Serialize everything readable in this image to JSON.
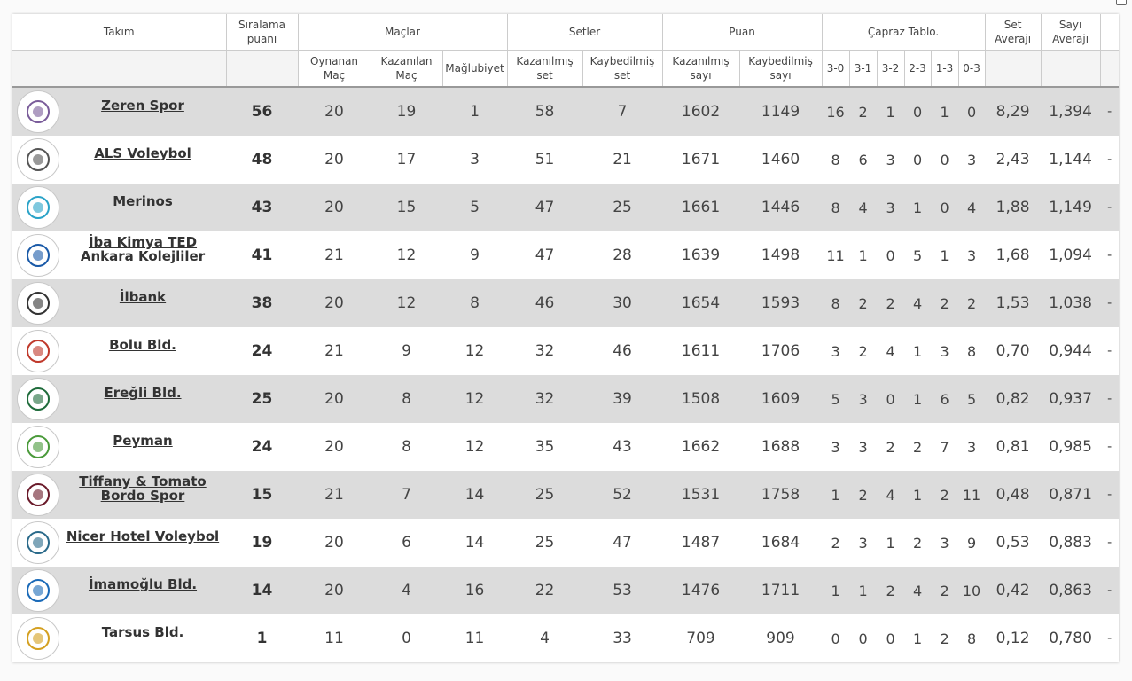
{
  "columns": {
    "takim": "Takım",
    "siralama": "Sıralama puanı",
    "maclar": "Maçlar",
    "setler": "Setler",
    "puan": "Puan",
    "capraz": "Çapraz Tablo.",
    "set_averaji": "Set Averajı",
    "sayi_averaji": "Sayı Averajı",
    "oynanan": "Oynanan Maç",
    "kazanilan": "Kazanılan Maç",
    "maglubiyet": "Mağlubiyet",
    "kazanilmis_set": "Kazanılmış set",
    "kaybedilmis_set": "Kaybedilmiş set",
    "kazanilmis_sayi": "Kazanılmış sayı",
    "kaybedilmis_sayi": "Kaybedilmiş sayı",
    "c30": "3-0",
    "c31": "3-1",
    "c32": "3-2",
    "c23": "2-3",
    "c13": "1-3",
    "c03": "0-3"
  },
  "rows": [
    {
      "team": "Zeren Spor",
      "logo_color": "#7a5c9a",
      "points": "56",
      "played": "20",
      "won": "19",
      "lost": "1",
      "sets_won": "58",
      "sets_lost": "7",
      "pts_won": "1602",
      "pts_lost": "1149",
      "c30": "16",
      "c31": "2",
      "c32": "1",
      "c23": "0",
      "c13": "1",
      "c03": "0",
      "set_avg": "8,29",
      "pt_avg": "1,394",
      "extra": "-"
    },
    {
      "team": "ALS Voleybol",
      "logo_color": "#555555",
      "points": "48",
      "played": "20",
      "won": "17",
      "lost": "3",
      "sets_won": "51",
      "sets_lost": "21",
      "pts_won": "1671",
      "pts_lost": "1460",
      "c30": "8",
      "c31": "6",
      "c32": "3",
      "c23": "0",
      "c13": "0",
      "c03": "3",
      "set_avg": "2,43",
      "pt_avg": "1,144",
      "extra": "-"
    },
    {
      "team": "Merinos",
      "logo_color": "#2aa3c8",
      "points": "43",
      "played": "20",
      "won": "15",
      "lost": "5",
      "sets_won": "47",
      "sets_lost": "25",
      "pts_won": "1661",
      "pts_lost": "1446",
      "c30": "8",
      "c31": "4",
      "c32": "3",
      "c23": "1",
      "c13": "0",
      "c03": "4",
      "set_avg": "1,88",
      "pt_avg": "1,149",
      "extra": "-"
    },
    {
      "team": "İba Kimya TED Ankara Kolejliler",
      "logo_color": "#1a5aa8",
      "points": "41",
      "played": "21",
      "won": "12",
      "lost": "9",
      "sets_won": "47",
      "sets_lost": "28",
      "pts_won": "1639",
      "pts_lost": "1498",
      "c30": "11",
      "c31": "1",
      "c32": "0",
      "c23": "5",
      "c13": "1",
      "c03": "3",
      "set_avg": "1,68",
      "pt_avg": "1,094",
      "extra": "-"
    },
    {
      "team": "İlbank",
      "logo_color": "#333333",
      "points": "38",
      "played": "20",
      "won": "12",
      "lost": "8",
      "sets_won": "46",
      "sets_lost": "30",
      "pts_won": "1654",
      "pts_lost": "1593",
      "c30": "8",
      "c31": "2",
      "c32": "2",
      "c23": "4",
      "c13": "2",
      "c03": "2",
      "set_avg": "1,53",
      "pt_avg": "1,038",
      "extra": "-"
    },
    {
      "team": "Bolu Bld.",
      "logo_color": "#c0392b",
      "points": "24",
      "played": "21",
      "won": "9",
      "lost": "12",
      "sets_won": "32",
      "sets_lost": "46",
      "pts_won": "1611",
      "pts_lost": "1706",
      "c30": "3",
      "c31": "2",
      "c32": "4",
      "c23": "1",
      "c13": "3",
      "c03": "8",
      "set_avg": "0,70",
      "pt_avg": "0,944",
      "extra": "-"
    },
    {
      "team": "Ereğli Bld.",
      "logo_color": "#1e6b3a",
      "points": "25",
      "played": "20",
      "won": "8",
      "lost": "12",
      "sets_won": "32",
      "sets_lost": "39",
      "pts_won": "1508",
      "pts_lost": "1609",
      "c30": "5",
      "c31": "3",
      "c32": "0",
      "c23": "1",
      "c13": "6",
      "c03": "5",
      "set_avg": "0,82",
      "pt_avg": "0,937",
      "extra": "-"
    },
    {
      "team": "Peyman",
      "logo_color": "#4a9a3a",
      "points": "24",
      "played": "20",
      "won": "8",
      "lost": "12",
      "sets_won": "35",
      "sets_lost": "43",
      "pts_won": "1662",
      "pts_lost": "1688",
      "c30": "3",
      "c31": "3",
      "c32": "2",
      "c23": "2",
      "c13": "7",
      "c03": "3",
      "set_avg": "0,81",
      "pt_avg": "0,985",
      "extra": "-"
    },
    {
      "team": "Tiffany & Tomato Bordo Spor",
      "logo_color": "#6a1a2a",
      "points": "15",
      "played": "21",
      "won": "7",
      "lost": "14",
      "sets_won": "25",
      "sets_lost": "52",
      "pts_won": "1531",
      "pts_lost": "1758",
      "c30": "1",
      "c31": "2",
      "c32": "4",
      "c23": "1",
      "c13": "2",
      "c03": "11",
      "set_avg": "0,48",
      "pt_avg": "0,871",
      "extra": "-"
    },
    {
      "team": "Nicer Hotel Voleybol",
      "logo_color": "#2a6a8a",
      "points": "19",
      "played": "20",
      "won": "6",
      "lost": "14",
      "sets_won": "25",
      "sets_lost": "47",
      "pts_won": "1487",
      "pts_lost": "1684",
      "c30": "2",
      "c31": "3",
      "c32": "1",
      "c23": "2",
      "c13": "3",
      "c03": "9",
      "set_avg": "0,53",
      "pt_avg": "0,883",
      "extra": "-"
    },
    {
      "team": "İmamoğlu Bld.",
      "logo_color": "#1a6ab8",
      "points": "14",
      "played": "20",
      "won": "4",
      "lost": "16",
      "sets_won": "22",
      "sets_lost": "53",
      "pts_won": "1476",
      "pts_lost": "1711",
      "c30": "1",
      "c31": "1",
      "c32": "2",
      "c23": "4",
      "c13": "2",
      "c03": "10",
      "set_avg": "0,42",
      "pt_avg": "0,863",
      "extra": "-"
    },
    {
      "team": "Tarsus Bld.",
      "logo_color": "#d4a020",
      "points": "1",
      "played": "11",
      "won": "0",
      "lost": "11",
      "sets_won": "4",
      "sets_lost": "33",
      "pts_won": "709",
      "pts_lost": "909",
      "c30": "0",
      "c31": "0",
      "c32": "0",
      "c23": "1",
      "c13": "2",
      "c03": "8",
      "set_avg": "0,12",
      "pt_avg": "0,780",
      "extra": "-"
    }
  ]
}
